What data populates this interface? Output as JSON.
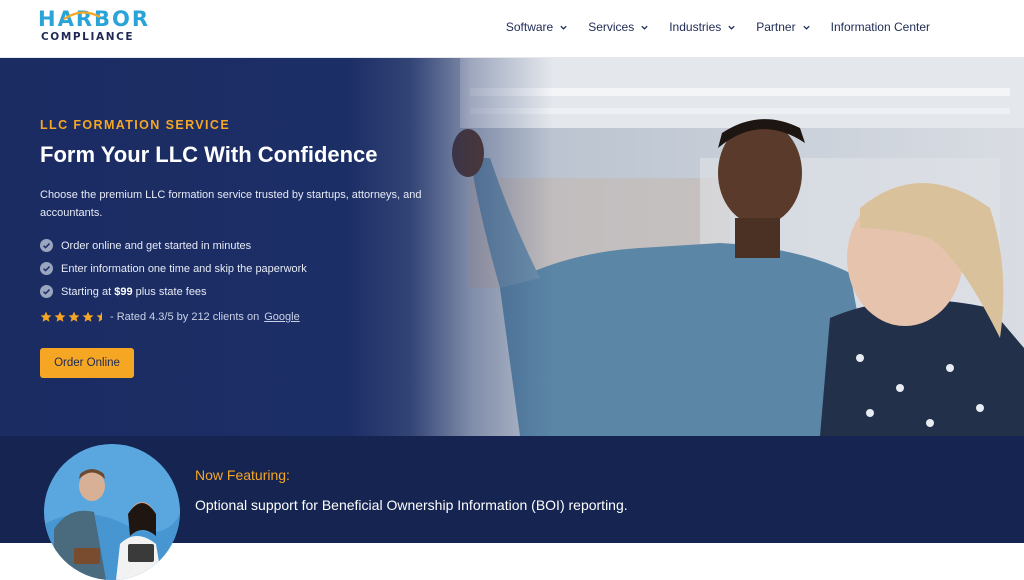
{
  "brand": {
    "name_top": "HARBOR",
    "name_bottom": "COMPLIANCE",
    "primary_color": "#1e2a55",
    "accent_color": "#2aa3d9"
  },
  "nav": {
    "items": [
      {
        "label": "Software",
        "has_dropdown": true
      },
      {
        "label": "Services",
        "has_dropdown": true
      },
      {
        "label": "Industries",
        "has_dropdown": true
      },
      {
        "label": "Partner",
        "has_dropdown": true
      },
      {
        "label": "Information Center",
        "has_dropdown": false
      }
    ]
  },
  "hero": {
    "eyebrow": "LLC FORMATION SERVICE",
    "title": "Form Your LLC With Confidence",
    "description": "Choose the premium LLC formation service trusted by startups, attorneys, and accountants.",
    "bullets": {
      "b1": "Order online and get started in minutes",
      "b2": "Enter information one time and skip the paperwork",
      "b3_prefix": "Starting at ",
      "b3_price": "$99",
      "b3_suffix": " plus state fees"
    },
    "rating": {
      "stars": 4.5,
      "text": "- Rated 4.3/5 by 212 clients on",
      "link": "Google"
    },
    "cta": "Order Online",
    "accent_color": "#f5a623",
    "background_color": "#1c2e66"
  },
  "feature": {
    "label": "Now Featuring:",
    "text": "Optional support for Beneficial Ownership Information (BOI) reporting.",
    "background_color": "#152451"
  }
}
